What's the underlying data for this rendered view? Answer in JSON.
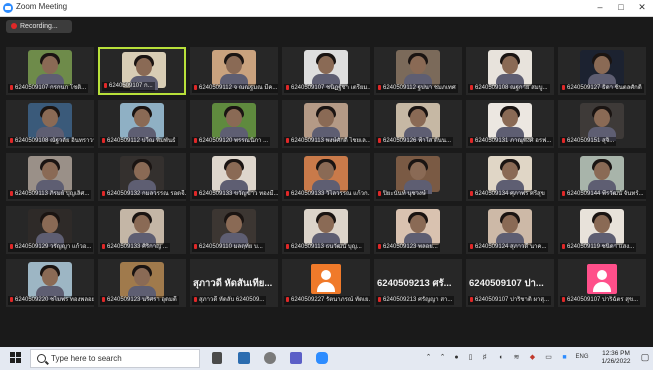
{
  "window": {
    "title": "Zoom Meeting",
    "minimize": "–",
    "maximize": "□",
    "close": "✕"
  },
  "recording": {
    "label": "Recording..."
  },
  "colors": {
    "accent": "#b8e03a",
    "muted": "#e02828",
    "zoom_blue": "#2d8cff"
  },
  "participants": [
    {
      "name": "6240509107 กรกนก โชติ...",
      "bg": "#6e8b4a",
      "active": false
    },
    {
      "name": "6240509107 ก...",
      "bg": "#d8cdb5",
      "active": true
    },
    {
      "name": "6240509112 จ ณณฐมณ มีค...",
      "bg": "#c9a27e",
      "active": false
    },
    {
      "name": "6240509107 ชนิฏฐ์ชา เตรียม...",
      "bg": "#dedede",
      "active": false
    },
    {
      "name": "6240509112 ฐปนา ชมภเทศ",
      "bg": "#7b6a5a",
      "active": false
    },
    {
      "name": "6240509108 ณฐกาย สมบู...",
      "bg": "#e8e3dc",
      "active": false
    },
    {
      "name": "6240509127 ธิดา ชินตลศักดิ์",
      "bg": "#1c2230",
      "active": false
    },
    {
      "name": "6240509108 ณัฐวลัย อินทราวาส...",
      "bg": "#3a5a7a",
      "active": false
    },
    {
      "name": "6240509112 ปวีณ พิมพันธ์",
      "bg": "#8fb0c4",
      "active": false
    },
    {
      "name": "6240509120 พรรณนิภา ...",
      "bg": "#5f8a3e",
      "active": false
    },
    {
      "name": "6240509113 พงษ์ศักดิ์ ไชยเล...",
      "bg": "#b49a86",
      "active": false
    },
    {
      "name": "6240509126 ฟ้าใส ต้นน...",
      "bg": "#c6b8a4",
      "active": false
    },
    {
      "name": "6240509131 ภาณุพงศ์ อรฟ...",
      "bg": "#ece7e1",
      "active": false
    },
    {
      "name": "6240509151 สุจิ...",
      "bg": "#3e3a38",
      "active": false
    },
    {
      "name": "6240509113 ภิรมย์ บุญเลิศ...",
      "bg": "#9a9088",
      "active": false
    },
    {
      "name": "6240509132 กมลวรรณ รอดจี...",
      "bg": "#34302e",
      "active": false
    },
    {
      "name": "6240509133 ขวัญข้าว ทองมี...",
      "bg": "#ded6cc",
      "active": false
    },
    {
      "name": "6240509133 วิไลวรรณ แก้วก...",
      "bg": "#c97a4a",
      "active": false
    },
    {
      "name": "ปิยะนันท์ นุชวงษ์",
      "bg": "#7a5a44",
      "active": false
    },
    {
      "name": "6240509134 ศุภาพร ศรีสุข",
      "bg": "#e0d6c6",
      "active": false
    },
    {
      "name": "6240509144 พีรวัฒน์ จันทร์...",
      "bg": "#a8b4aa",
      "active": false
    },
    {
      "name": "6240509129 วรัญญา แก้วอ...",
      "bg": "#2e2a28",
      "active": false
    },
    {
      "name": "6240509133 ศิริกาญ ...",
      "bg": "#c4b6a6",
      "active": false
    },
    {
      "name": "6240509110 มลฤทัย บ...",
      "bg": "#3c3632",
      "active": false
    },
    {
      "name": "6240509113 ธนวัฒน์ บุญ...",
      "bg": "#dcd4ca",
      "active": false
    },
    {
      "name": "6240509123 พลอย...",
      "bg": "#d9c2b0",
      "active": false
    },
    {
      "name": "6240509124 สุภาวดี นาค...",
      "bg": "#cdb9a7",
      "active": false
    },
    {
      "name": "6240509119 ชนิดา แสง...",
      "bg": "#e8e2da",
      "active": false
    },
    {
      "name": "6240509220 ชไมพร ทองพลอย",
      "bg": "#9db6c4",
      "active": false
    },
    {
      "name": "6240509123 นริศรา อุดมดี",
      "bg": "#a07a4c",
      "active": false
    },
    {
      "name": "สุภาวดี หัดลับ 6240509...",
      "big": "สุภาวดี หัดสันเทีย...",
      "active": false
    },
    {
      "name": "6240509227 รัตนาภรณ์ ทัดเย...",
      "avatar": "#f07a2a",
      "active": false
    },
    {
      "name": "6240509213 ศรัญญา สา...",
      "big": "6240509213 ศรั...",
      "active": false
    },
    {
      "name": "6240509107 ปาริชาติ ผาสุ...",
      "big": "6240509107 ปา...",
      "active": false
    },
    {
      "name": "6240509107 ปาริฉัตร สุข...",
      "avatar": "#ff4f8a",
      "active": false
    }
  ],
  "taskbar": {
    "search_placeholder": "Type here to search",
    "time": "12:36 PM",
    "date": "1/26/2022",
    "lang": "ENG"
  }
}
